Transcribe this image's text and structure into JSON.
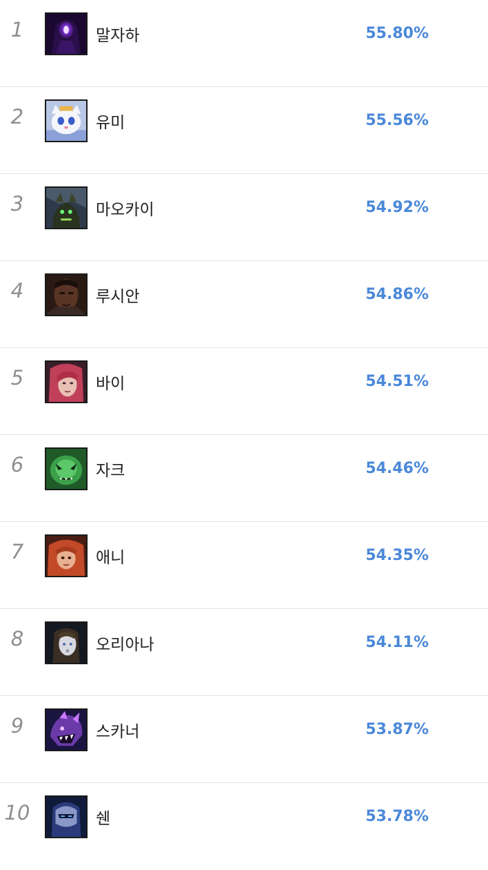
{
  "colors": {
    "accent": "#4a88d9",
    "rank_text": "#8e8e8e",
    "name_text": "#222222",
    "divider": "#e2e2e2"
  },
  "champions": [
    {
      "rank": "1",
      "name": "말자하",
      "win_rate": "55.80%",
      "icon": "malzahar-portrait-icon"
    },
    {
      "rank": "2",
      "name": "유미",
      "win_rate": "55.56%",
      "icon": "yuumi-portrait-icon"
    },
    {
      "rank": "3",
      "name": "마오카이",
      "win_rate": "54.92%",
      "icon": "maokai-portrait-icon"
    },
    {
      "rank": "4",
      "name": "루시안",
      "win_rate": "54.86%",
      "icon": "lucian-portrait-icon"
    },
    {
      "rank": "5",
      "name": "바이",
      "win_rate": "54.51%",
      "icon": "vi-portrait-icon"
    },
    {
      "rank": "6",
      "name": "자크",
      "win_rate": "54.46%",
      "icon": "zac-portrait-icon"
    },
    {
      "rank": "7",
      "name": "애니",
      "win_rate": "54.35%",
      "icon": "annie-portrait-icon"
    },
    {
      "rank": "8",
      "name": "오리아나",
      "win_rate": "54.11%",
      "icon": "orianna-portrait-icon"
    },
    {
      "rank": "9",
      "name": "스카너",
      "win_rate": "53.87%",
      "icon": "skarner-portrait-icon"
    },
    {
      "rank": "10",
      "name": "쉔",
      "win_rate": "53.78%",
      "icon": "shen-portrait-icon"
    }
  ]
}
